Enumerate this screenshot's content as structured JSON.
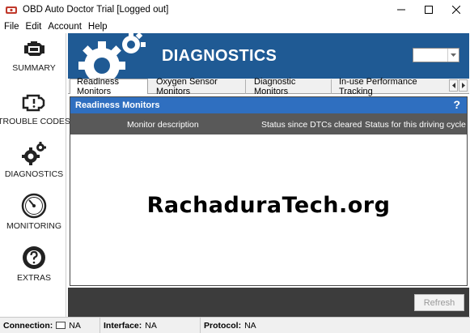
{
  "window": {
    "title": "OBD Auto Doctor Trial [Logged out]"
  },
  "menu": [
    "File",
    "Edit",
    "Account",
    "Help"
  ],
  "sidebar": {
    "items": [
      {
        "label": "SUMMARY",
        "icon": "engine-icon"
      },
      {
        "label": "TROUBLE CODES",
        "icon": "check-engine-icon"
      },
      {
        "label": "DIAGNOSTICS",
        "icon": "gears-icon"
      },
      {
        "label": "MONITORING",
        "icon": "gauge-icon"
      },
      {
        "label": "EXTRAS",
        "icon": "help-ring-icon"
      }
    ]
  },
  "banner": {
    "title": "DIAGNOSTICS"
  },
  "tabs": [
    "Readiness Monitors",
    "Oxygen Sensor Monitors",
    "Diagnostic Monitors",
    "In-use Performance Tracking"
  ],
  "panel": {
    "title": "Readiness Monitors",
    "help": "?",
    "columns": [
      "Monitor description",
      "Status since DTCs cleared",
      "Status for this driving cycle"
    ],
    "watermark": "RachaduraTech.org"
  },
  "actions": {
    "refresh": "Refresh"
  },
  "status": {
    "connection_label": "Connection:",
    "connection_value": "NA",
    "interface_label": "Interface:",
    "interface_value": "NA",
    "protocol_label": "Protocol:",
    "protocol_value": "NA"
  },
  "colors": {
    "banner": "#1f5a94",
    "panel_header": "#2f6fc0",
    "column_header": "#595959",
    "bottom_bar": "#3c3c3c"
  }
}
